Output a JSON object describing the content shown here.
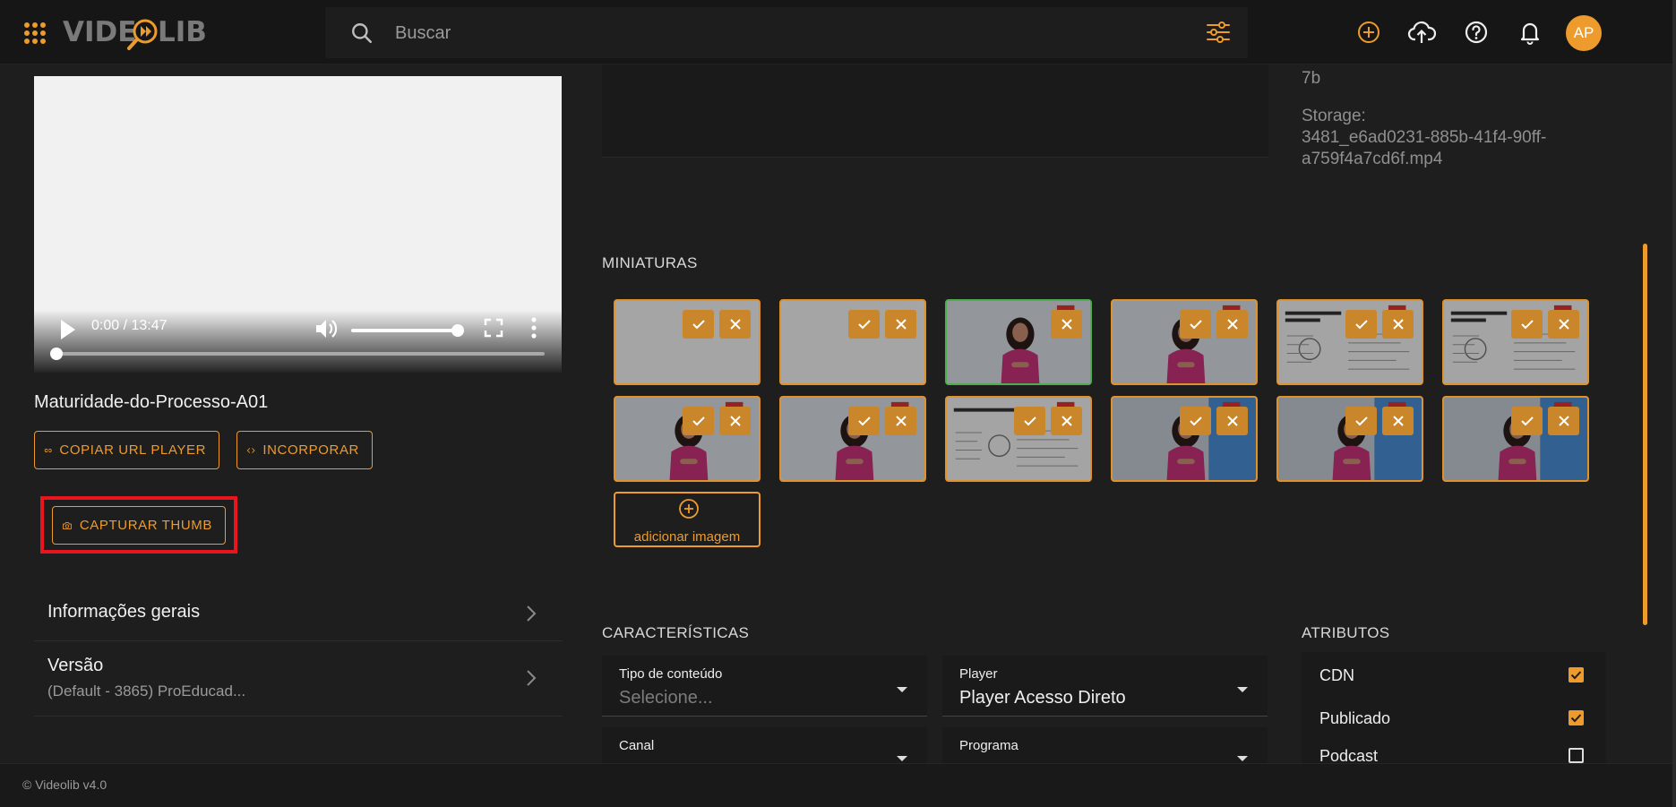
{
  "app": {
    "brand": "VIDEOLIB",
    "footer": "© Videolib v4.0",
    "accent": "#ed9b2c"
  },
  "header": {
    "search_placeholder": "Buscar",
    "avatar_initials": "AP",
    "icons": [
      "apps-grid-icon",
      "search-icon",
      "filter-sliders-icon",
      "add-circle-icon",
      "cloud-upload-icon",
      "help-icon",
      "bell-icon"
    ]
  },
  "video": {
    "time": "0:00 / 13:47",
    "title": "Maturidade-do-Processo-A01",
    "progress": 0,
    "volume": 1
  },
  "actions": {
    "copy_url": "COPIAR URL PLAYER",
    "embed": "INCORPORAR",
    "capture": "CAPTURAR THUMB"
  },
  "accordion": [
    {
      "title": "Informações gerais",
      "subtitle": ""
    },
    {
      "title": "Versão",
      "subtitle": "(Default - 3865) ProEducad..."
    }
  ],
  "meta": {
    "id_tail": "7b",
    "storage_label": "Storage:",
    "storage_line1": "3481_e6ad0231-885b-41f4-90ff-",
    "storage_line2": "a759f4a7cd6f.mp4"
  },
  "thumbnails": {
    "title": "MINIATURAS",
    "add_label": "adicionar imagem",
    "items": [
      {
        "kind": "blank",
        "selected": false
      },
      {
        "kind": "blank",
        "selected": false
      },
      {
        "kind": "person",
        "selected": true
      },
      {
        "kind": "person",
        "selected": false
      },
      {
        "kind": "slide",
        "slide_title": "Maturidade do Processo Produtivo",
        "selected": false
      },
      {
        "kind": "slide",
        "slide_title": "Maturidade do Processo Produtivo",
        "selected": false
      },
      {
        "kind": "person",
        "selected": false
      },
      {
        "kind": "person",
        "selected": false
      },
      {
        "kind": "slide-wide",
        "slide_title": "Maturidade do Processo Produtivo",
        "selected": false
      },
      {
        "kind": "person-blue",
        "selected": false
      },
      {
        "kind": "person-blue",
        "selected": false
      },
      {
        "kind": "person-blue",
        "selected": false
      }
    ]
  },
  "characteristics": {
    "title": "CARACTERÍSTICAS",
    "fields": [
      {
        "label": "Tipo de conteúdo",
        "value": "Selecione...",
        "placeholder": true
      },
      {
        "label": "Player",
        "value": "Player Acesso Direto",
        "placeholder": false
      },
      {
        "label": "Canal",
        "value": "",
        "placeholder": true
      },
      {
        "label": "Programa",
        "value": "",
        "placeholder": true
      }
    ]
  },
  "attributes": {
    "title": "ATRIBUTOS",
    "items": [
      {
        "label": "CDN",
        "checked": true
      },
      {
        "label": "Publicado",
        "checked": true
      },
      {
        "label": "Podcast",
        "checked": false
      }
    ]
  }
}
